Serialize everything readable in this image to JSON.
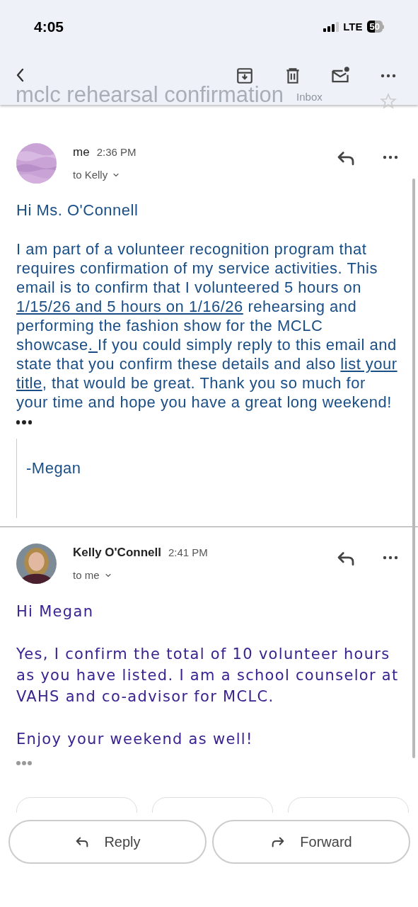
{
  "status_bar": {
    "time": "4:05",
    "network": "LTE",
    "battery": "50"
  },
  "subject": {
    "title": "mclc rehearsal confirmation",
    "label": "Inbox"
  },
  "messages": [
    {
      "sender": "me",
      "time": "2:36 PM",
      "recipients": "to Kelly",
      "greeting": "Hi Ms. O'Connell",
      "paragraphs": [
        [
          {
            "text": "I am part of a volunteer recognition program that requires confirmation of my service activities. This email is to confirm that I volunteered 5 hours on ",
            "underlined": false
          },
          {
            "text": "1/15/26 and 5 hours on 1/16/26",
            "underlined": true
          },
          {
            "text": " rehearsing and performing the fashion show for the MCLC showcase",
            "underlined": false
          },
          {
            "text": ". ",
            "underlined": true
          },
          {
            "text": "If you could simply reply to this email and state that you confirm these details and also ",
            "underlined": false
          },
          {
            "text": "list your title",
            "underlined": true
          },
          {
            "text": ", that would be great. Thank you so much for your time and hope you have a great long weekend!",
            "underlined": false
          }
        ]
      ],
      "quoted": "-Megan"
    },
    {
      "sender": "Kelly O'Connell",
      "time": "2:41 PM",
      "recipients": "to me",
      "greeting": "Hi Megan",
      "paragraphs": [
        [
          {
            "text": "Yes, I confirm the total of 10 volunteer hours as you have listed. I am a school counselor at VAHS and co-advisor for MCLC.",
            "underlined": false
          }
        ],
        [
          {
            "text": "Enjoy your weekend as well!",
            "underlined": false
          }
        ]
      ]
    }
  ],
  "actions": [
    {
      "kind": "reply",
      "label": "Reply"
    },
    {
      "kind": "forward",
      "label": "Forward"
    }
  ]
}
